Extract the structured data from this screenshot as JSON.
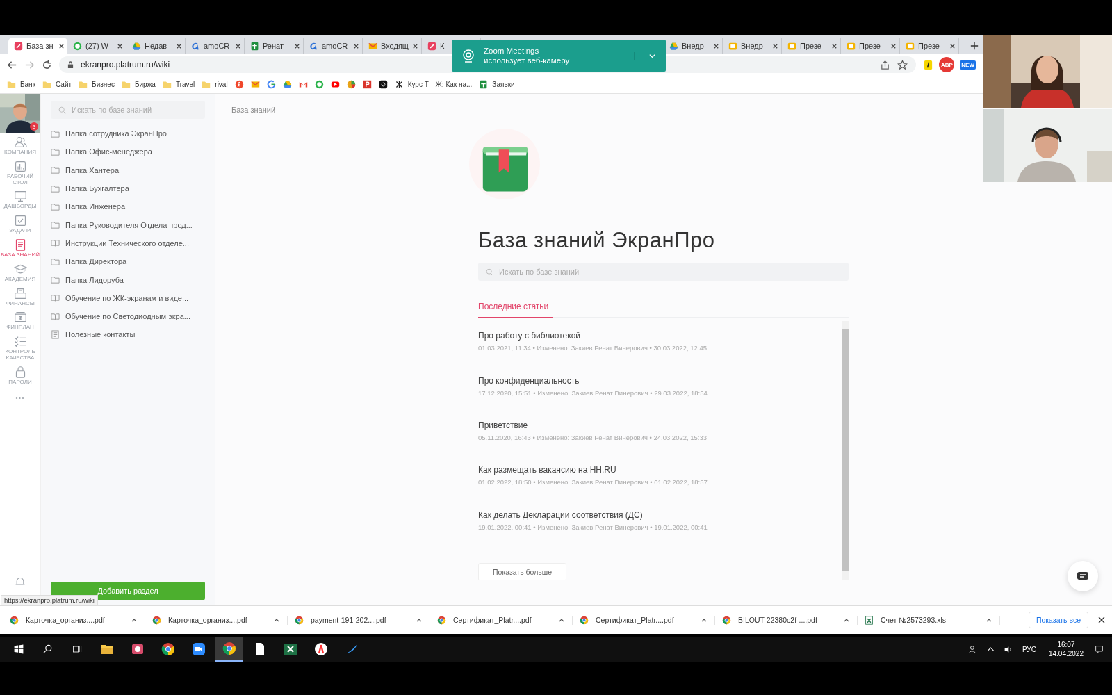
{
  "browser": {
    "tabs": [
      {
        "label": "База зн",
        "kind": "platrum",
        "selected": true
      },
      {
        "label": "(27) W",
        "kind": "chat",
        "selected": false
      },
      {
        "label": "Недав",
        "kind": "drive",
        "selected": false
      },
      {
        "label": "amoCR",
        "kind": "amo",
        "selected": false
      },
      {
        "label": "Ренат",
        "kind": "sheet",
        "selected": false
      },
      {
        "label": "amoCR",
        "kind": "amo",
        "selected": false
      },
      {
        "label": "Входящ",
        "kind": "mail",
        "selected": false
      },
      {
        "label": "К",
        "kind": "platrum",
        "selected": false
      },
      {
        "label": "Внедр",
        "kind": "drive",
        "selected": false
      },
      {
        "label": "Внедр",
        "kind": "slides",
        "selected": false
      },
      {
        "label": "Презе",
        "kind": "slides",
        "selected": false
      },
      {
        "label": "Презе",
        "kind": "slides",
        "selected": false
      },
      {
        "label": "Презе",
        "kind": "slides",
        "selected": false
      }
    ],
    "url": "ekranpro.platrum.ru/wiki",
    "extensions": [
      {
        "kind": "yellow"
      },
      {
        "kind": "abp",
        "text": "ABP"
      },
      {
        "kind": "new",
        "text": "NEW"
      }
    ],
    "bookmarks": [
      {
        "kind": "folder",
        "label": "Банк"
      },
      {
        "kind": "folder",
        "label": "Сайт"
      },
      {
        "kind": "folder",
        "label": "Бизнес"
      },
      {
        "kind": "folder",
        "label": "Биржа"
      },
      {
        "kind": "folder",
        "label": "Travel"
      },
      {
        "kind": "folder",
        "label": "rival"
      },
      {
        "kind": "yandex"
      },
      {
        "kind": "mail"
      },
      {
        "kind": "google"
      },
      {
        "kind": "drive"
      },
      {
        "kind": "gmail"
      },
      {
        "kind": "chat"
      },
      {
        "kind": "video"
      },
      {
        "kind": "pie"
      },
      {
        "kind": "p"
      },
      {
        "kind": "cam"
      },
      {
        "kind": "tj",
        "label": "Курс Т—Ж: Как на..."
      },
      {
        "kind": "sheet",
        "label": "Заявки"
      }
    ],
    "status_url": "https://ekranpro.platrum.ru/wiki"
  },
  "notification": {
    "title": "Zoom Meetings",
    "text": "использует веб-камеру"
  },
  "app_nav": {
    "badge": "3",
    "items": [
      {
        "label": "КОМПАНИЯ",
        "kind": "company",
        "selected": false
      },
      {
        "label": "РАБОЧИЙ СТОЛ",
        "kind": "desk",
        "selected": false
      },
      {
        "label": "ДАШБОРДЫ",
        "kind": "monitor",
        "selected": false
      },
      {
        "label": "ЗАДАЧИ",
        "kind": "tasks",
        "selected": false
      },
      {
        "label": "БАЗА ЗНАНИЙ",
        "kind": "wiki",
        "selected": true
      },
      {
        "label": "АКАДЕМИЯ",
        "kind": "academy",
        "selected": false
      },
      {
        "label": "ФИНАНСЫ",
        "kind": "finance",
        "selected": false
      },
      {
        "label": "ФИНПЛАН",
        "kind": "finplan",
        "selected": false
      },
      {
        "label": "КОНТРОЛЬ КАЧЕСТВА",
        "kind": "quality",
        "selected": false
      },
      {
        "label": "ПАРОЛИ",
        "kind": "lock",
        "selected": false
      }
    ],
    "more": "•••"
  },
  "wiki_sidebar": {
    "search_placeholder": "Искать по базе знаний",
    "sections": [
      {
        "kind": "folder",
        "label": "Папка сотрудника ЭкранПро"
      },
      {
        "kind": "folder",
        "label": "Папка Офис-менеджера"
      },
      {
        "kind": "folder",
        "label": "Папка Хантера"
      },
      {
        "kind": "folder",
        "label": "Папка Бухгалтера"
      },
      {
        "kind": "folder",
        "label": "Папка Инженера"
      },
      {
        "kind": "folder",
        "label": "Папка Руководителя Отдела прод..."
      },
      {
        "kind": "book",
        "label": "Инструкции Технического отделе..."
      },
      {
        "kind": "folder",
        "label": "Папка Директора"
      },
      {
        "kind": "folder",
        "label": "Папка Лидоруба"
      },
      {
        "kind": "book",
        "label": "Обучение по ЖК-экранам и виде..."
      },
      {
        "kind": "book",
        "label": "Обучение по Светодиодным экра..."
      },
      {
        "kind": "doc",
        "label": "Полезные контакты"
      }
    ],
    "add_button": "Добавить раздел"
  },
  "main": {
    "breadcrumb": "База знаний",
    "title": "База знаний ЭкранПро",
    "search_placeholder": "Искать по базе знаний",
    "tabs": [
      {
        "label": "Последние статьи",
        "selected": true
      }
    ],
    "articles": [
      {
        "title": "Про работу с библиотекой",
        "meta": "01.03.2021, 11:34 • Изменено: Закиев Ренат Винерович • 30.03.2022, 12:45",
        "divider": true
      },
      {
        "title": "Про конфиденциальность",
        "meta": "17.12.2020, 15:51 • Изменено: Закиев Ренат Винерович • 29.03.2022, 18:54",
        "divider": false
      },
      {
        "title": "Приветствие",
        "meta": "05.11.2020, 16:43 • Изменено: Закиев Ренат Винерович • 24.03.2022, 15:33",
        "divider": false
      },
      {
        "title": "Как размещать вакансию на HH.RU",
        "meta": "01.02.2022, 18:50 • Изменено: Закиев Ренат Винерович • 01.02.2022, 18:57",
        "divider": true
      },
      {
        "title": "Как делать Декларации соответствия (ДС)",
        "meta": "19.01.2022, 00:41 • Изменено: Закиев Ренат Винерович • 19.01.2022, 00:41",
        "divider": false
      }
    ],
    "show_more": "Показать больше"
  },
  "downloads": {
    "items": [
      {
        "name": "Карточка_организ....pdf",
        "kind": "pdf"
      },
      {
        "name": "Карточка_организ....pdf",
        "kind": "pdf"
      },
      {
        "name": "payment-191-202....pdf",
        "kind": "pdf"
      },
      {
        "name": "Сертификат_Platr....pdf",
        "kind": "pdf"
      },
      {
        "name": "Сертификат_Platr....pdf",
        "kind": "pdf"
      },
      {
        "name": "BILOUT-22380c2f-....pdf",
        "kind": "pdf"
      },
      {
        "name": "Счет №2573293.xls",
        "kind": "xls"
      }
    ],
    "show_all": "Показать все"
  },
  "taskbar": {
    "apps": [
      {
        "kind": "explorer",
        "selected": false
      },
      {
        "kind": "photos",
        "selected": false
      },
      {
        "kind": "chrome",
        "selected": false
      },
      {
        "kind": "zoom",
        "selected": false
      },
      {
        "kind": "chrome",
        "selected": true
      },
      {
        "kind": "file",
        "selected": false
      },
      {
        "kind": "excel",
        "selected": false
      },
      {
        "kind": "yandex",
        "selected": false
      },
      {
        "kind": "pen",
        "selected": false
      }
    ],
    "lang": "РУС",
    "time": "16:07",
    "date": "14.04.2022"
  }
}
